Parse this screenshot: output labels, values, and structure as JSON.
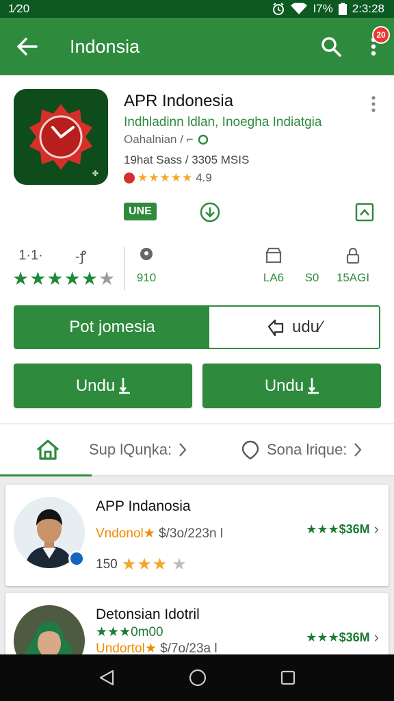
{
  "status_bar": {
    "time": "1⁄20",
    "battery": "I7%",
    "clock": "2:3:28"
  },
  "app_bar": {
    "title": "Indonsia",
    "notification_count": "20",
    "color": "#2e8b3d"
  },
  "app": {
    "name": "APR Indonesia",
    "subtitle": "Indhladinn ldlan, Inoegha Indiatgia",
    "developer": "Oahalnian / ⌐",
    "meta": "19hat Sass / 3305 MSIS",
    "rating_stars": "★★★★★",
    "rating_value": "4.9",
    "badge": "UNE"
  },
  "stats": {
    "rating_top": "1·1·",
    "rating_stars_full": "★★★★★",
    "rating_stars_empty": "★",
    "downloads_top": "-ꝭ",
    "downloads_value": "910",
    "stat3_value": "LA6",
    "stat4_value": "S0",
    "stat5_value": "15AGI"
  },
  "actions": {
    "segment_left": "Pot jomesia",
    "segment_right": "udu⁄",
    "button_left": "Undu",
    "button_right": "Undu"
  },
  "tabs": [
    {
      "label": "Sup lQuηka:",
      "icon": "home-icon"
    },
    {
      "label": "Sona lrique:",
      "icon": "chat-bubble-icon"
    }
  ],
  "cards": [
    {
      "title": "APP Indanosia",
      "sub_highlight": "Vndonol★",
      "sub_rest": " $/3o/223n l",
      "count": "150",
      "stars_full": "★★★",
      "stars_empty": "★",
      "price": "★★★$36M"
    },
    {
      "title": "Detonsian Idotril",
      "sub_line": "★★★0m00",
      "sub_highlight": "Undortol★",
      "sub_rest": " $/7o/23a l",
      "price": "★★★$36M"
    }
  ]
}
